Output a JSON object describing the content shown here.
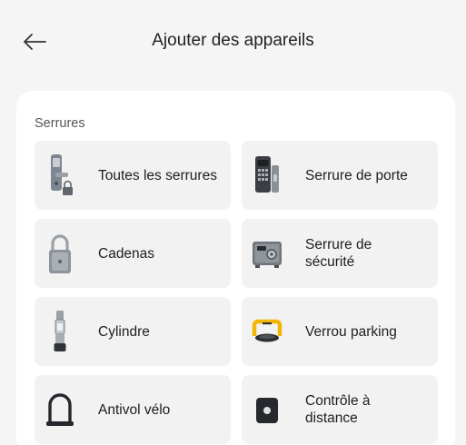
{
  "header": {
    "title": "Ajouter des appareils",
    "back_icon": "arrow-left-icon"
  },
  "section": {
    "title": "Serrures",
    "items": [
      {
        "label": "Toutes les serrures",
        "icon": "smart-lock-icon"
      },
      {
        "label": "Serrure de porte",
        "icon": "door-lock-keypad-icon"
      },
      {
        "label": "Cadenas",
        "icon": "padlock-icon"
      },
      {
        "label": "Serrure de\nsécurité",
        "icon": "safe-icon"
      },
      {
        "label": "Cylindre",
        "icon": "cylinder-lock-icon"
      },
      {
        "label": "Verrou parking",
        "icon": "parking-lock-icon"
      },
      {
        "label": "Antivol vélo",
        "icon": "bike-lock-icon"
      },
      {
        "label": "Contrôle à\ndistance",
        "icon": "remote-control-icon"
      }
    ]
  },
  "colors": {
    "background": "#f5f5f5",
    "card": "#ffffff",
    "tile": "#f2f2f2",
    "parking_accent": "#f2b705"
  }
}
